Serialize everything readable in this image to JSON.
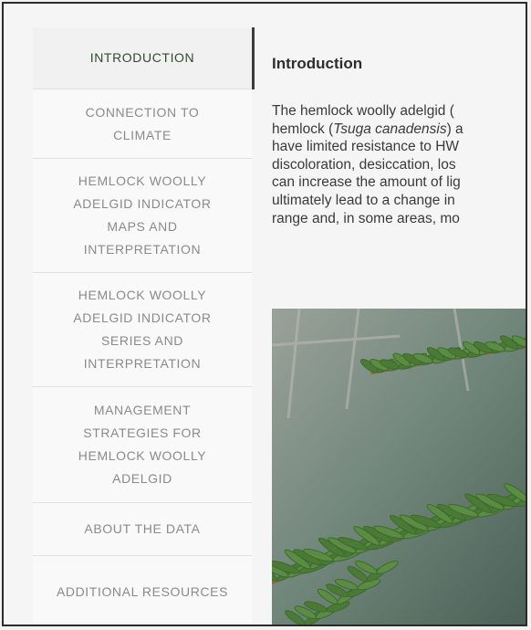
{
  "sidebar": {
    "items": [
      {
        "label": "INTRODUCTION",
        "active": true
      },
      {
        "label": "CONNECTION TO CLIMATE"
      },
      {
        "label": "HEMLOCK WOOLLY ADELGID INDICATOR MAPS AND INTERPRETATION"
      },
      {
        "label": "HEMLOCK WOOLLY ADELGID INDICATOR SERIES AND INTERPRETATION"
      },
      {
        "label": "MANAGEMENT STRATEGIES FOR HEMLOCK WOOLLY ADELGID"
      },
      {
        "label": "ABOUT THE DATA"
      },
      {
        "label": "ADDITIONAL RESOURCES"
      }
    ]
  },
  "main": {
    "title": "Introduction",
    "paragraph": {
      "line1": "The hemlock woolly adelgid (",
      "line2_before": "hemlock (",
      "line2_italic": "Tsuga canadensis",
      "line2_after": ") a",
      "line3": "have limited resistance to HW",
      "line4": "discoloration, desiccation, los",
      "line5": "can increase the amount of lig",
      "line6": "ultimately lead to a change in",
      "line7": "range and, in some areas, mo"
    }
  },
  "colors": {
    "active_text": "#2f4a2f",
    "inactive_text": "#8a8a8a",
    "needle_green": "#4f7f3a"
  }
}
